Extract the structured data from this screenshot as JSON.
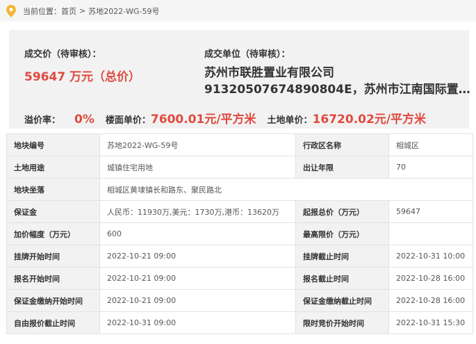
{
  "breadcrumb": {
    "prefix": "当前位置：",
    "home": "首页",
    "separator": ">",
    "current": "苏地2022-WG-59号"
  },
  "summary": {
    "deal_price_label": "成交价（待审核）：",
    "deal_price_value": "59647 万元（总价）",
    "winner_label": "成交单位（待审核）：",
    "winner_name": "苏州市联胜置业有限公司",
    "winner_detail": "91320507674890804E，苏州市江南国际置…",
    "premium_label": "溢价率：",
    "premium_value": "0%",
    "floor_price_label": "楼面单价：",
    "floor_price_value": "7600.01元/平方米",
    "land_price_label": "土地单价：",
    "land_price_value": "16720.02元/平方米",
    "accent_color": "#e04a3f"
  },
  "table": {
    "rows": [
      {
        "k1": "地块编号",
        "v1": "苏地2022-WG-59号",
        "k2": "行政区名称",
        "v2": "相城区"
      },
      {
        "k1": "土地用途",
        "v1": "城镇住宅用地",
        "k2": "出让年限",
        "v2": "70"
      },
      {
        "k1": "地块坐落",
        "v1": "相城区黄埭镇长和路东、聚民路北"
      },
      {
        "k1": "保证金",
        "v1": "人民币：11930万,美元：1730万,港币：13620万",
        "k2": "起报总价（万元）",
        "v2": "59647"
      },
      {
        "k1": "加价幅度（万元）",
        "v1": "600",
        "k2": "最高限价（万元）",
        "v2": ""
      },
      {
        "k1": "挂牌开始时间",
        "v1": "2022-10-21 09:00",
        "k2": "挂牌截止时间",
        "v2": "2022-10-31 10:00"
      },
      {
        "k1": "报名开始时间",
        "v1": "2022-10-21 09:00",
        "k2": "报名截止时间",
        "v2": "2022-10-28 16:00"
      },
      {
        "k1": "保证金缴纳开始时间",
        "v1": "2022-10-21 09:00",
        "k2": "保证金缴纳截止时间",
        "v2": "2022-10-28 16:00"
      },
      {
        "k1": "自由报价截止时间",
        "v1": "2022-10-31 09:00",
        "k2": "限时竞价开始时间",
        "v2": "2022-10-31 15:30"
      }
    ]
  }
}
